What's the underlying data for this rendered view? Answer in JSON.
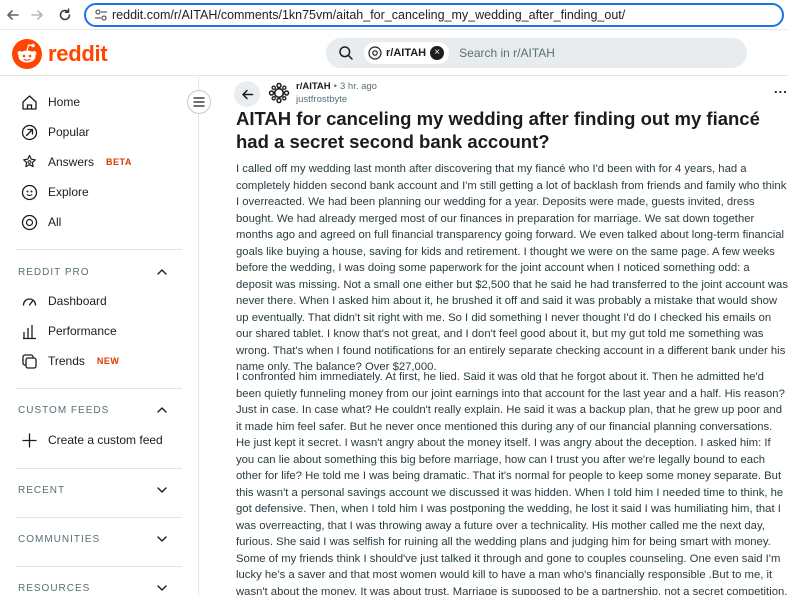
{
  "browser": {
    "url": "reddit.com/r/AITAH/comments/1kn75vm/aitah_for_canceling_my_wedding_after_finding_out/"
  },
  "header": {
    "logo_text": "reddit",
    "search_chip": "r/AITAH",
    "search_placeholder": "Search in r/AITAH"
  },
  "sidebar": {
    "nav": [
      {
        "label": "Home",
        "icon": "home-icon"
      },
      {
        "label": "Popular",
        "icon": "popular-icon"
      },
      {
        "label": "Answers",
        "icon": "answers-icon",
        "badge": "BETA"
      },
      {
        "label": "Explore",
        "icon": "explore-icon"
      },
      {
        "label": "All",
        "icon": "all-icon"
      }
    ],
    "reddit_pro": {
      "title": "REDDIT PRO",
      "items": [
        {
          "label": "Dashboard",
          "icon": "dashboard-icon"
        },
        {
          "label": "Performance",
          "icon": "performance-icon"
        },
        {
          "label": "Trends",
          "icon": "trends-icon",
          "badge": "NEW"
        }
      ]
    },
    "custom_feeds": {
      "title": "CUSTOM FEEDS",
      "items": [
        {
          "label": "Create a custom feed",
          "icon": "plus-icon"
        }
      ]
    },
    "recent": {
      "title": "RECENT"
    },
    "communities": {
      "title": "COMMUNITIES"
    },
    "resources": {
      "title": "RESOURCES"
    }
  },
  "post": {
    "subreddit": "r/AITAH",
    "separator": "•",
    "time": "3 hr. ago",
    "author": "justfrostbyte",
    "more": "...",
    "title": "AITAH for canceling my wedding after finding out my fiancé had a secret second bank account?",
    "paragraphs": [
      "I called off my wedding last month after discovering that my fiancé who I'd been with for 4 years, had a completely hidden second bank account and I'm still getting a lot of backlash from friends and family who think I overreacted. We had been planning our wedding for a year. Deposits were made, guests invited, dress bought. We had already merged most of our finances in preparation for marriage. We sat down together months ago and agreed on full financial transparency going forward. We even talked about long-term financial goals like buying a house, saving for kids and retirement. I thought we were on the same page. A few weeks before the wedding, I was doing some paperwork for the joint account when I noticed something odd: a deposit was missing. Not a small one either but $2,500 that he said he had transferred to the joint account was never there. When I asked him about it, he brushed it off and said it was probably a mistake that would show up eventually. That didn't sit right with me. So I did something I never thought I'd do I checked his emails on our shared tablet. I know that's not great, and I don't feel good about it, but my gut told me something was wrong. That's when I found notifications for an entirely separate checking account in a different bank under his name only. The balance? Over $27,000.",
      "I confronted him immediately. At first, he lied. Said it was old that he forgot about it. Then he admitted he'd been quietly funneling money from our joint earnings into that account for the last year and a half. His reason? Just in case. In case what? He couldn't really explain. He said it was a backup plan, that he grew up poor and it made him feel safer. But he never once mentioned this during any of our financial planning conversations. He just kept it secret. I wasn't angry about the money itself. I was angry about the deception. I asked him: If you can lie about something this big before marriage, how can I trust you after we're legally bound to each other for life? He told me I was being dramatic. That it's normal for people to keep some money separate. But this wasn't a personal savings account we discussed it was hidden. When I told him I needed time to think, he got defensive. Then, when I told him I was postponing the wedding, he lost it said I was humiliating him, that I was overreacting, that I was throwing away a future over a technicality. His mother called me the next day, furious. She said I was selfish for ruining all the wedding plans and judging him for being smart with money. Some of my friends think I should've just talked it through and gone to couples counseling. One even said I'm lucky he's a saver and that most women would kill to have a man who's financially responsible .But to me, it wasn't about the money. It was about trust. Marriage is supposed to be a partnership, not a secret competition. AITA for canceling my wedding over a hidden bank account?"
    ]
  }
}
